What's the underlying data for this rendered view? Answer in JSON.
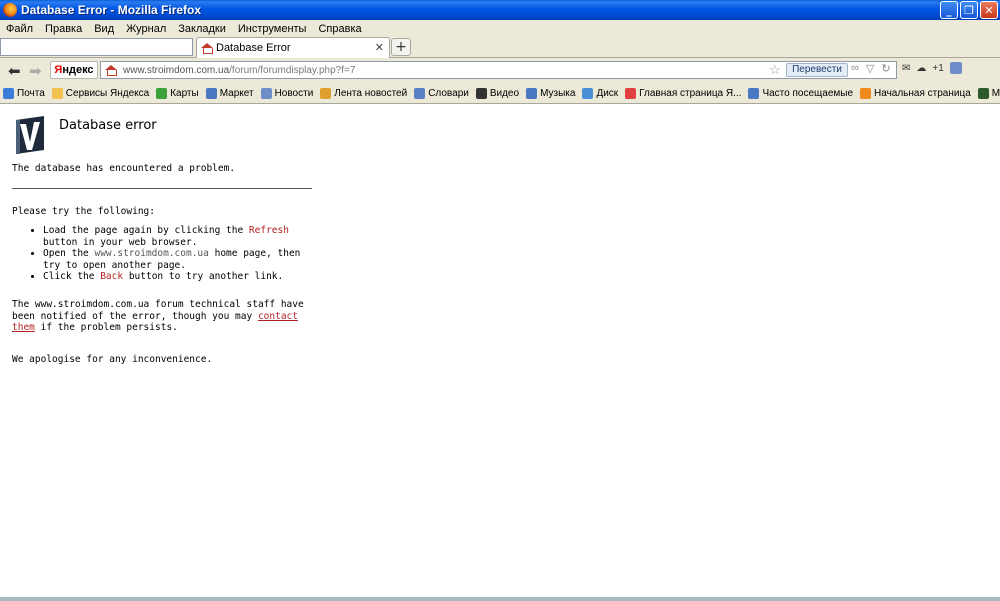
{
  "window": {
    "title": "Database Error - Mozilla Firefox",
    "buttons": [
      "minimize",
      "maximize",
      "close"
    ]
  },
  "menu": [
    "Файл",
    "Правка",
    "Вид",
    "Журнал",
    "Закладки",
    "Инструменты",
    "Справка"
  ],
  "tabs": [
    {
      "label": "Database Error",
      "favicon": "house-icon"
    }
  ],
  "newtab_label": "+",
  "nav": {
    "yandex_label_ya": "Я",
    "yandex_label_rest": "ндекс",
    "url_host": "www.stroimdom.com.ua",
    "url_path": "/forum/forumdisplay.php?f=7",
    "translate_label": "Перевести",
    "counter_label": "+1"
  },
  "bookmarks": [
    {
      "label": "Почта",
      "color": "#3b7dd8"
    },
    {
      "label": "Сервисы Яндекса",
      "color": "#f2c14e"
    },
    {
      "label": "Карты",
      "color": "#3aa13a"
    },
    {
      "label": "Маркет",
      "color": "#4a78c2"
    },
    {
      "label": "Новости",
      "color": "#6d8ec9"
    },
    {
      "label": "Лента новостей",
      "color": "#e0a030"
    },
    {
      "label": "Словари",
      "color": "#5b7fc4"
    },
    {
      "label": "Видео",
      "color": "#333333"
    },
    {
      "label": "Музыка",
      "color": "#4a78c2"
    },
    {
      "label": "Диск",
      "color": "#4a90d9"
    },
    {
      "label": "Главная страница Я...",
      "color": "#e04040"
    },
    {
      "label": "Часто посещаемые",
      "color": "#4a78c2"
    },
    {
      "label": "Начальная страница",
      "color": "#f08a1c"
    },
    {
      "label": "Mail.Ru",
      "color": "#2c5a2c"
    }
  ],
  "page": {
    "heading": "Database error",
    "intro": "The database has encountered a problem.",
    "try_heading": "Please try the following:",
    "items": [
      {
        "pre": "Load the page again by clicking the ",
        "link": "Refresh",
        "post": " button in your web browser."
      },
      {
        "pre": "Open the ",
        "link": "www.stroimdom.com.ua",
        "post": " home page, then try to open another page."
      },
      {
        "pre": "Click the ",
        "link": "Back",
        "post": " button to try another link."
      }
    ],
    "notified_pre": "The www.stroimdom.com.ua forum technical staff have been notified of the error, though you may ",
    "notified_link": "contact them",
    "notified_post": " if the problem persists.",
    "apology": "We apologise for any inconvenience."
  }
}
